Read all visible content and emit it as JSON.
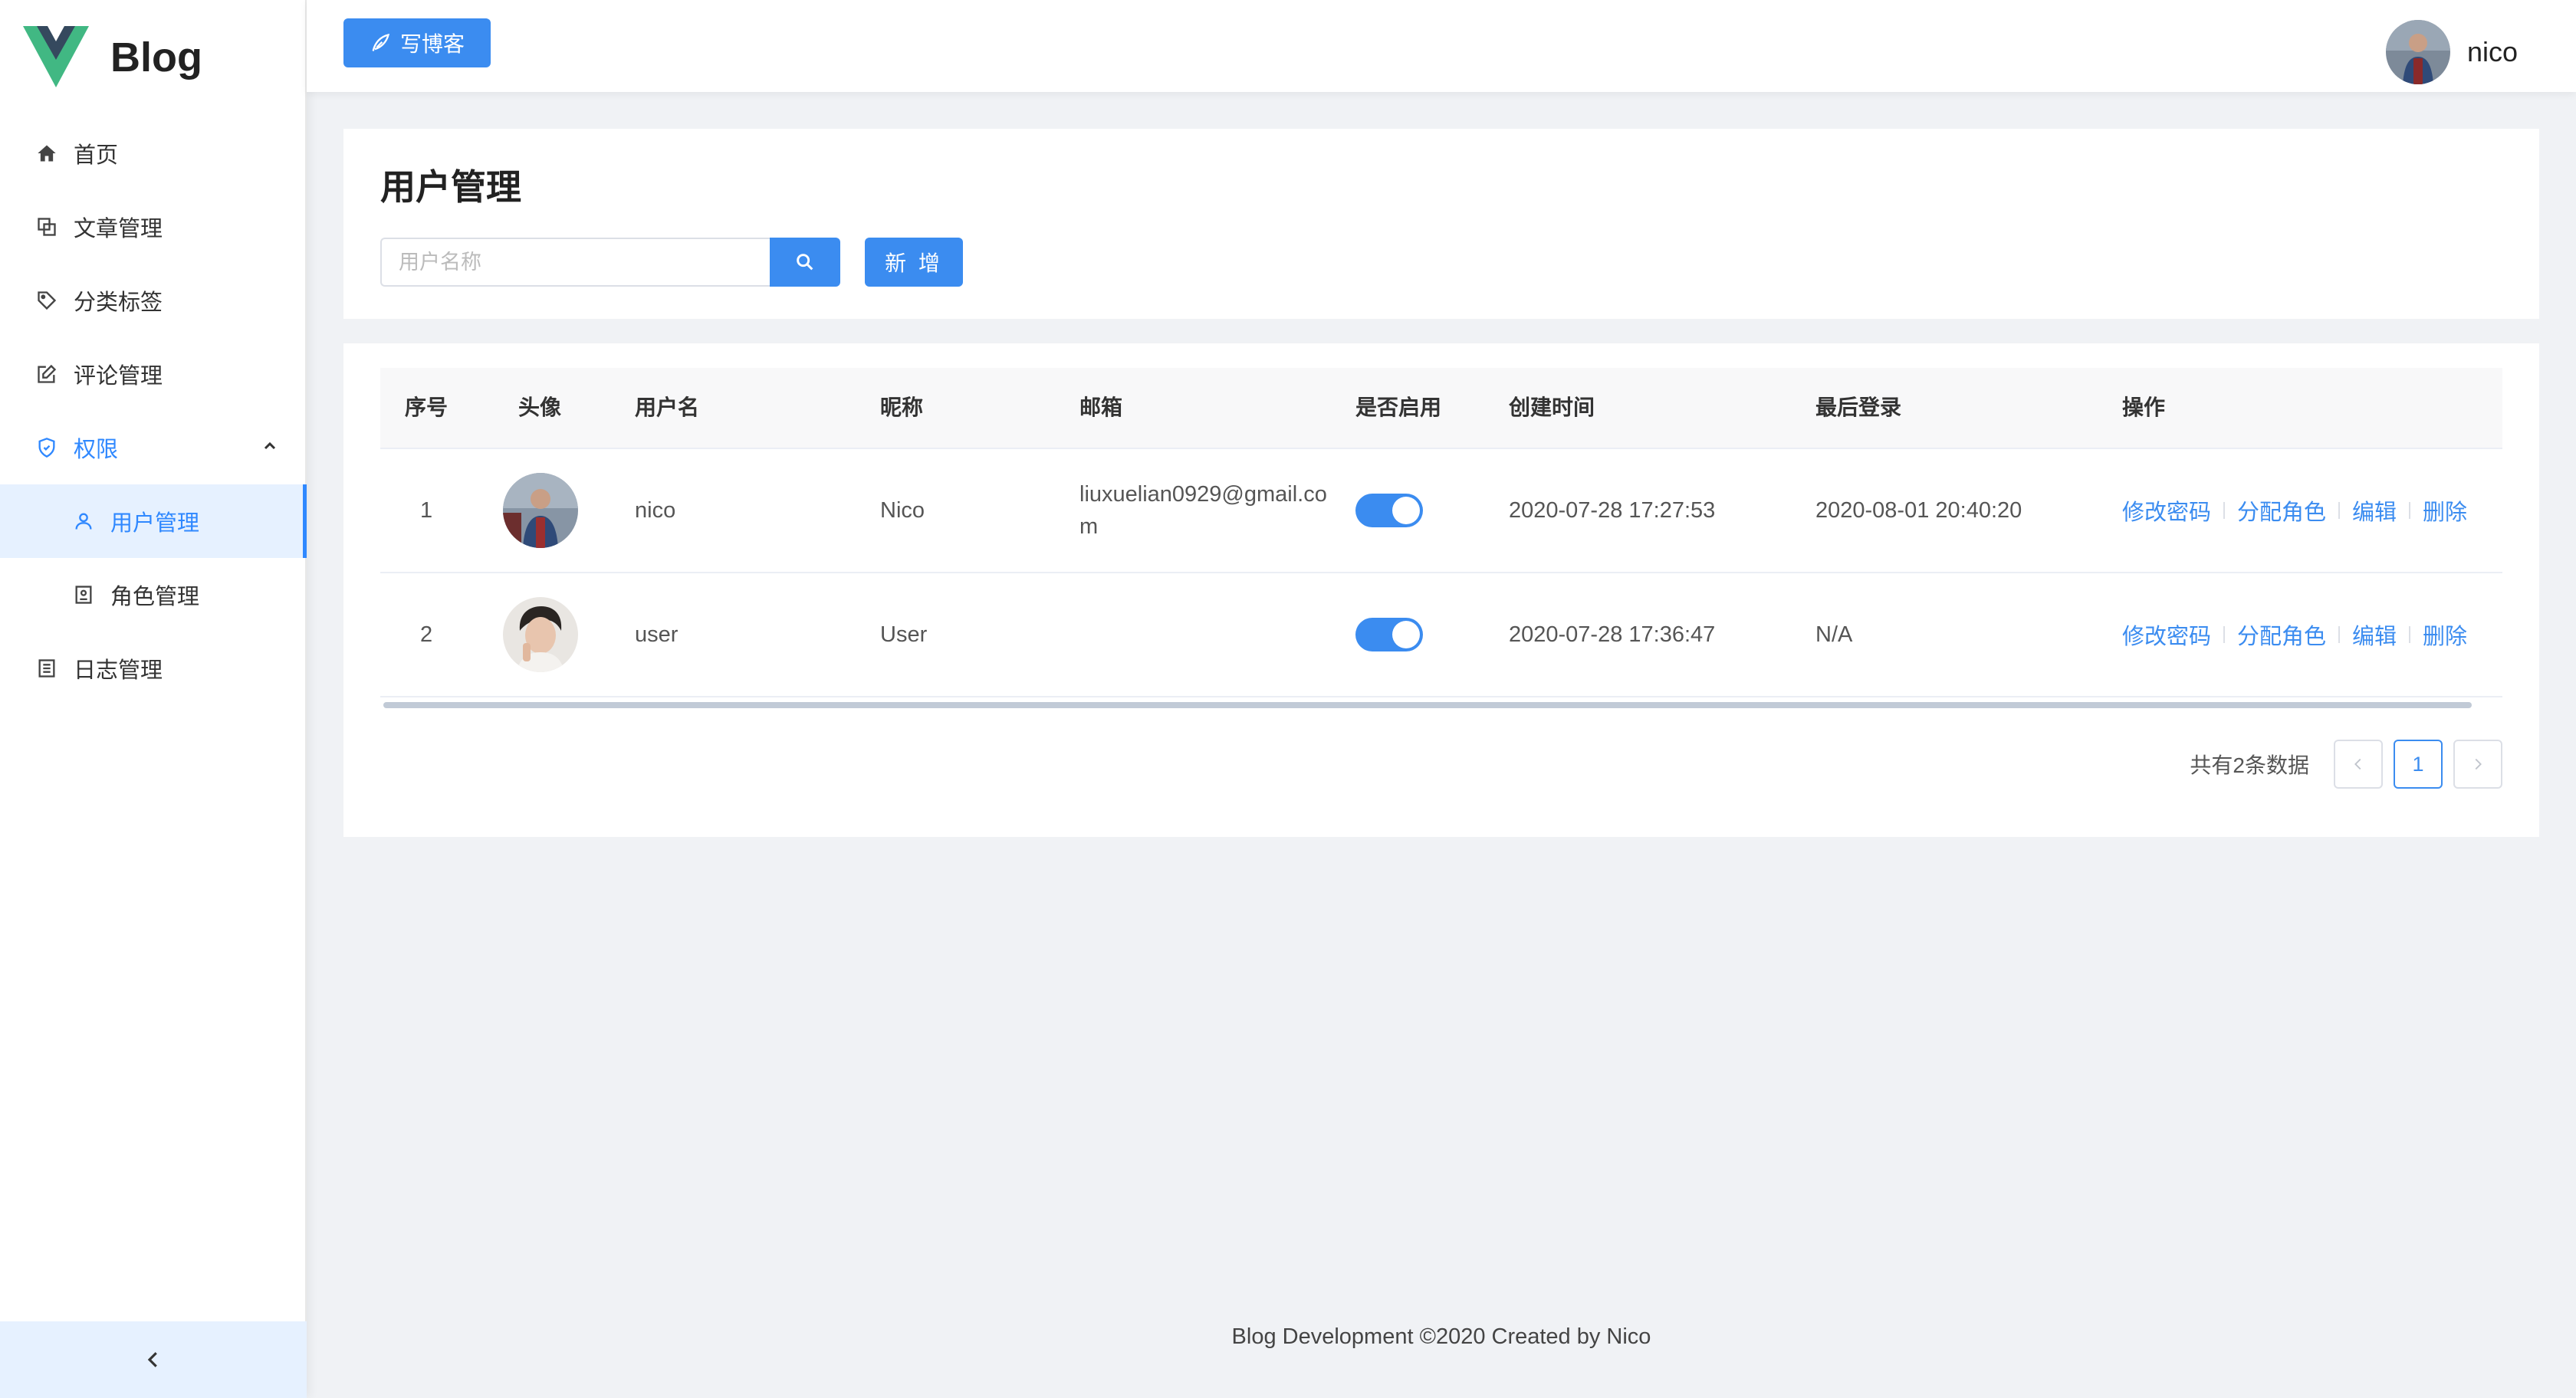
{
  "app": {
    "logo_text": "Blog"
  },
  "sidebar": {
    "items": [
      {
        "label": "首页",
        "icon": "home-icon"
      },
      {
        "label": "文章管理",
        "icon": "copy-icon"
      },
      {
        "label": "分类标签",
        "icon": "tag-icon"
      },
      {
        "label": "评论管理",
        "icon": "edit-icon"
      },
      {
        "label": "权限",
        "icon": "shield-icon",
        "expanded": true,
        "children": [
          {
            "label": "用户管理",
            "icon": "user-icon",
            "active": true
          },
          {
            "label": "角色管理",
            "icon": "id-card-icon"
          }
        ]
      },
      {
        "label": "日志管理",
        "icon": "list-icon"
      }
    ],
    "collapse_icon": "chevron-left-icon"
  },
  "header": {
    "write_button": "写博客",
    "username": "nico"
  },
  "page": {
    "title": "用户管理",
    "search": {
      "placeholder": "用户名称",
      "value": ""
    },
    "add_button": "新 增"
  },
  "table": {
    "columns": [
      "序号",
      "头像",
      "用户名",
      "昵称",
      "邮箱",
      "是否启用",
      "创建时间",
      "最后登录",
      "操作"
    ],
    "rows": [
      {
        "index": "1",
        "username": "nico",
        "nickname": "Nico",
        "email": "liuxuelian0929@gmail.com",
        "enabled": true,
        "created": "2020-07-28 17:27:53",
        "last_login": "2020-08-01 20:40:20"
      },
      {
        "index": "2",
        "username": "user",
        "nickname": "User",
        "email": "",
        "enabled": true,
        "created": "2020-07-28 17:36:47",
        "last_login": "N/A"
      }
    ],
    "actions": [
      "修改密码",
      "分配角色",
      "编辑",
      "删除"
    ]
  },
  "pagination": {
    "total_text": "共有2条数据",
    "current_page": "1"
  },
  "footer": {
    "text": "Blog Development ©2020 Created by Nico"
  },
  "colors": {
    "accent": "#3b8cf0",
    "active_bg": "#e6f1ff",
    "logo_green": "#41b883",
    "logo_dark": "#35495e"
  }
}
